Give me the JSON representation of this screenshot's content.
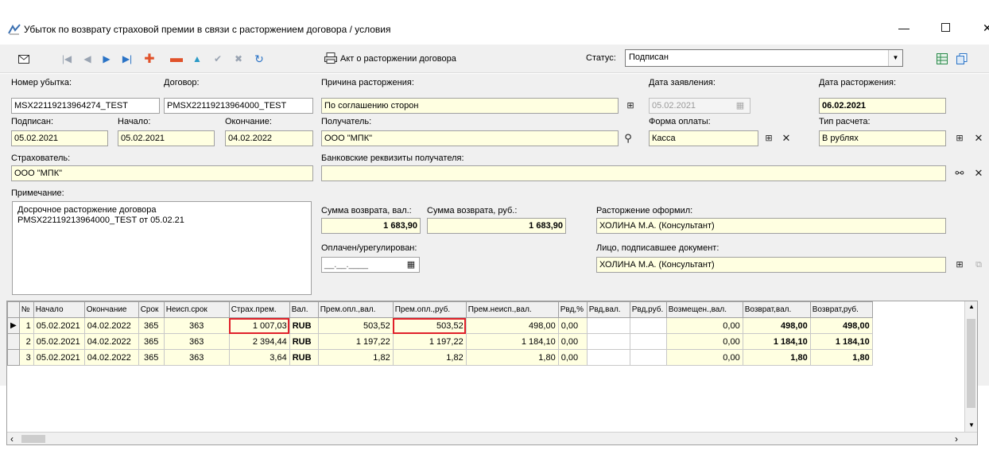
{
  "window": {
    "title": "Убыток по возврату страховой премии в связи с расторжением договора / условия",
    "min_glyph": "—",
    "close_glyph": "✕"
  },
  "toolbar": {
    "akt_label": "Акт о расторжении договора",
    "status_label": "Статус:",
    "status_value": "Подписан"
  },
  "form": {
    "loss_number_label": "Номер убытка:",
    "loss_number": "MSX22119213964274_TEST",
    "contract_label": "Договор:",
    "contract": "PMSX22119213964000_TEST",
    "reason_label": "Причина расторжения:",
    "reason": "По соглашению сторон",
    "application_date_label": "Дата заявления:",
    "application_date": "05.02.2021",
    "termination_date_label": "Дата расторжения:",
    "termination_date": "06.02.2021",
    "signed_label": "Подписан:",
    "signed": "05.02.2021",
    "start_label": "Начало:",
    "start": "05.02.2021",
    "end_label": "Окончание:",
    "end": "04.02.2022",
    "recipient_label": "Получатель:",
    "recipient": "ООО \"МПК\"",
    "payment_form_label": "Форма оплаты:",
    "payment_form": "Касса",
    "calc_type_label": "Тип расчета:",
    "calc_type": "В рублях",
    "insurer_label": "Страхователь:",
    "insurer": "ООО \"МПК\"",
    "bank_label": "Банковские реквизиты получателя:",
    "bank": "",
    "note_label": "Примечание:",
    "note_lines": [
      "Досрочное расторжение договора",
      "PMSX22119213964000_TEST от 05.02.21"
    ],
    "refund_cur_label": "Сумма возврата, вал.:",
    "refund_cur": "1 683,90",
    "refund_rub_label": "Сумма возврата, руб.:",
    "refund_rub": "1 683,90",
    "executed_by_label": "Расторжение оформил:",
    "executed_by": "ХОЛИНА М.А. (Консультант)",
    "paid_label": "Оплачен/урегулирован:",
    "paid_placeholder": "__.__.____",
    "signer_label": "Лицо, подписавшее документ:",
    "signer": "ХОЛИНА М.А. (Консультант)"
  },
  "grid": {
    "columns": [
      "№",
      "Начало",
      "Окончание",
      "Срок",
      "Неисп.срок",
      "Страх.прем.",
      "Вал.",
      "Прем.опл.,вал.",
      "Прем.опл.,руб.",
      "Прем.неисп.,вал.",
      "Рвд,%",
      "Рвд,вал.",
      "Рвд,руб.",
      "Возмещен.,вал.",
      "Возврат,вал.",
      "Возврат,руб."
    ],
    "rows": [
      [
        "1",
        "05.02.2021",
        "04.02.2022",
        "365",
        "363",
        "1 007,03",
        "RUB",
        "503,52",
        "503,52",
        "498,00",
        "0,00",
        "",
        "",
        "0,00",
        "498,00",
        "498,00"
      ],
      [
        "2",
        "05.02.2021",
        "04.02.2022",
        "365",
        "363",
        "2 394,44",
        "RUB",
        "1 197,22",
        "1 197,22",
        "1 184,10",
        "0,00",
        "",
        "",
        "0,00",
        "1 184,10",
        "1 184,10"
      ],
      [
        "3",
        "05.02.2021",
        "04.02.2022",
        "365",
        "363",
        "3,64",
        "RUB",
        "1,82",
        "1,82",
        "1,80",
        "0,00",
        "",
        "",
        "0,00",
        "1,80",
        "1,80"
      ]
    ]
  }
}
